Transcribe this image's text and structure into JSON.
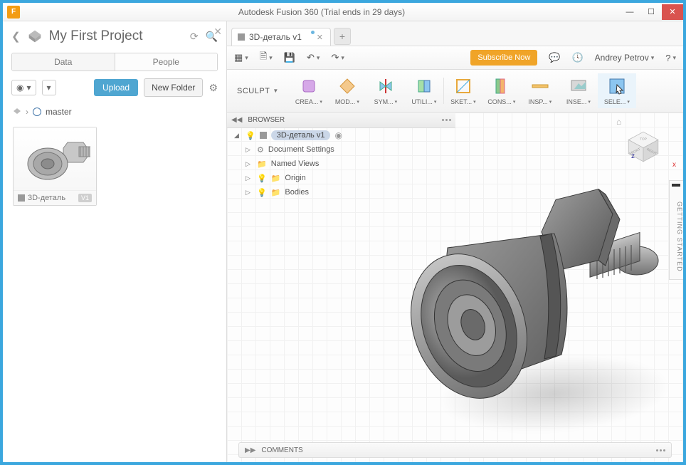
{
  "window": {
    "title": "Autodesk Fusion 360 (Trial ends in 29 days)"
  },
  "sidepanel": {
    "project_title": "My First Project",
    "tabs": {
      "data": "Data",
      "people": "People"
    },
    "upload": "Upload",
    "new_folder": "New Folder",
    "branch": "master",
    "thumb": {
      "name": "3D-деталь",
      "version": "V1"
    }
  },
  "doc_tab": {
    "label": "3D-деталь v1"
  },
  "toolbar": {
    "subscribe": "Subscribe Now",
    "user": "Andrey Petrov"
  },
  "workspace": "SCULPT",
  "ribbon": {
    "create": "CREA...",
    "modify": "MOD...",
    "symmetry": "SYM...",
    "utilities": "UTILI...",
    "sketch": "SKET...",
    "construct": "CONS...",
    "inspect": "INSP...",
    "insert": "INSE...",
    "select": "SELE..."
  },
  "browser": {
    "title": "BROWSER",
    "root": "3D-деталь v1",
    "doc_settings": "Document Settings",
    "named_views": "Named Views",
    "origin": "Origin",
    "bodies": "Bodies"
  },
  "viewcube": {
    "top": "TOP",
    "front": "FRONT",
    "right": "RIGHT"
  },
  "getting_started": "GETTING STARTED",
  "comments": "COMMENTS"
}
